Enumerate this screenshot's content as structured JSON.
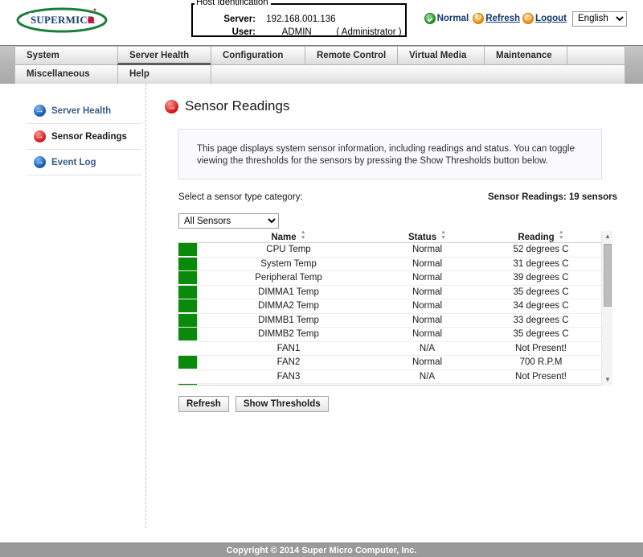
{
  "brand": {
    "logo_text": "SUPERMICR",
    "logo_dot_color": "#d4132a",
    "logo_ellipse_color": "#1c7d3e"
  },
  "host_identification": {
    "legend": "Host Identification",
    "server_label": "Server:",
    "server_value": "192.168.001.136",
    "user_label": "User:",
    "user_value": "ADMIN",
    "user_role": "( Administrator )"
  },
  "topbar": {
    "status_icon": "green-check-icon",
    "status_text": "Normal",
    "refresh_icon": "refresh-icon",
    "refresh_label": "Refresh",
    "logout_icon": "power-icon",
    "logout_label": "Logout",
    "language_selected": "English",
    "language_options": [
      "English"
    ]
  },
  "nav": {
    "row1": [
      {
        "label": "System",
        "active": false
      },
      {
        "label": "Server Health",
        "active": true
      },
      {
        "label": "Configuration",
        "active": false
      },
      {
        "label": "Remote Control",
        "active": false
      },
      {
        "label": "Virtual Media",
        "active": false
      },
      {
        "label": "Maintenance",
        "active": false
      }
    ],
    "row2": [
      {
        "label": "Miscellaneous",
        "active": false
      },
      {
        "label": "Help",
        "active": false
      }
    ]
  },
  "sidebar": {
    "items": [
      {
        "label": "Server Health",
        "icon": "blue-arrow-icon",
        "active": false
      },
      {
        "label": "Sensor Readings",
        "icon": "red-arrow-icon",
        "active": true
      },
      {
        "label": "Event Log",
        "icon": "blue-arrow-icon",
        "active": false
      }
    ]
  },
  "main": {
    "title": "Sensor Readings",
    "title_icon": "red-arrow-icon",
    "info_text": "This page displays system sensor information, including readings and status. You can toggle viewing the thresholds for the sensors by pressing the Show Thresholds button below.",
    "select_label": "Select a sensor type category:",
    "sensor_count_text": "Sensor Readings: 19 sensors",
    "category_selected": "All Sensors",
    "category_options": [
      "All Sensors"
    ],
    "table": {
      "columns": [
        "Name",
        "Status",
        "Reading"
      ],
      "rows": [
        {
          "led": "green",
          "name": "CPU Temp",
          "status": "Normal",
          "reading": "52 degrees C"
        },
        {
          "led": "green",
          "name": "System Temp",
          "status": "Normal",
          "reading": "31 degrees C"
        },
        {
          "led": "green",
          "name": "Peripheral Temp",
          "status": "Normal",
          "reading": "39 degrees C"
        },
        {
          "led": "green",
          "name": "DIMMA1 Temp",
          "status": "Normal",
          "reading": "35 degrees C"
        },
        {
          "led": "green",
          "name": "DIMMA2 Temp",
          "status": "Normal",
          "reading": "34 degrees C"
        },
        {
          "led": "green",
          "name": "DIMMB1 Temp",
          "status": "Normal",
          "reading": "33 degrees C"
        },
        {
          "led": "green",
          "name": "DIMMB2 Temp",
          "status": "Normal",
          "reading": "35 degrees C"
        },
        {
          "led": "none",
          "name": "FAN1",
          "status": "N/A",
          "reading": "Not Present!"
        },
        {
          "led": "green",
          "name": "FAN2",
          "status": "Normal",
          "reading": "700 R.P.M"
        },
        {
          "led": "none",
          "name": "FAN3",
          "status": "N/A",
          "reading": "Not Present!"
        },
        {
          "led": "green",
          "name": "",
          "status": "",
          "reading": ""
        }
      ]
    },
    "buttons": {
      "refresh": "Refresh",
      "show_thresholds": "Show Thresholds"
    }
  },
  "footer": {
    "copyright": "Copyright © 2014 Super Micro Computer, Inc."
  },
  "colors": {
    "led_green": "#0a8a0a",
    "link_blue": "#13386b",
    "sidebar_label": "#3b5a86",
    "footer_bg": "#9a9a9a"
  }
}
